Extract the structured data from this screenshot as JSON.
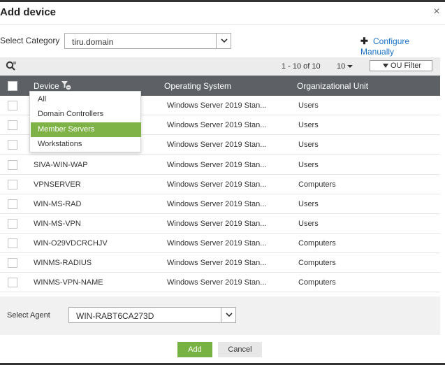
{
  "dialog": {
    "title": "Add device",
    "close_glyph": "×"
  },
  "category": {
    "label": "Select Category",
    "value": "tiru.domain"
  },
  "configure_manually": {
    "icon": "plus-icon",
    "label": "Configure Manually"
  },
  "toolbar": {
    "pager_text": "1 - 10 of 10",
    "per_page": "10",
    "ou_filter_label": "OU Filter"
  },
  "table": {
    "columns": [
      "Device",
      "Operating System",
      "Organizational Unit"
    ],
    "rows": [
      {
        "device": "",
        "os": "Windows Server 2019 Stan...",
        "ou": "Users"
      },
      {
        "device": "",
        "os": "Windows Server 2019 Stan...",
        "ou": "Users"
      },
      {
        "device": "",
        "os": "Windows Server 2019 Stan...",
        "ou": "Users"
      },
      {
        "device": "SIVA-WIN-WAP",
        "os": "Windows Server 2019 Stan...",
        "ou": "Users"
      },
      {
        "device": "VPNSERVER",
        "os": "Windows Server 2019 Stan...",
        "ou": "Computers"
      },
      {
        "device": "WIN-MS-RAD",
        "os": "Windows Server 2019 Stan...",
        "ou": "Users"
      },
      {
        "device": "WIN-MS-VPN",
        "os": "Windows Server 2019 Stan...",
        "ou": "Users"
      },
      {
        "device": "WIN-O29VDCRCHJV",
        "os": "Windows Server 2019 Stan...",
        "ou": "Computers"
      },
      {
        "device": "WINMS-RADIUS",
        "os": "Windows Server 2019 Stan...",
        "ou": "Computers"
      },
      {
        "device": "WINMS-VPN-NAME",
        "os": "Windows Server 2019 Stan...",
        "ou": "Computers"
      }
    ]
  },
  "device_filter_menu": {
    "options": [
      "All",
      "Domain Controllers",
      "Member Servers",
      "Workstations"
    ],
    "highlighted": "Member Servers"
  },
  "agent": {
    "label": "Select Agent",
    "value": "WIN-RABT6CA273D"
  },
  "buttons": {
    "add": "Add",
    "cancel": "Cancel"
  },
  "colors": {
    "header_bg": "#5d6166",
    "accent_green": "#78b242",
    "menu_highlight": "#7fb347",
    "link_blue": "#1a73c7"
  }
}
